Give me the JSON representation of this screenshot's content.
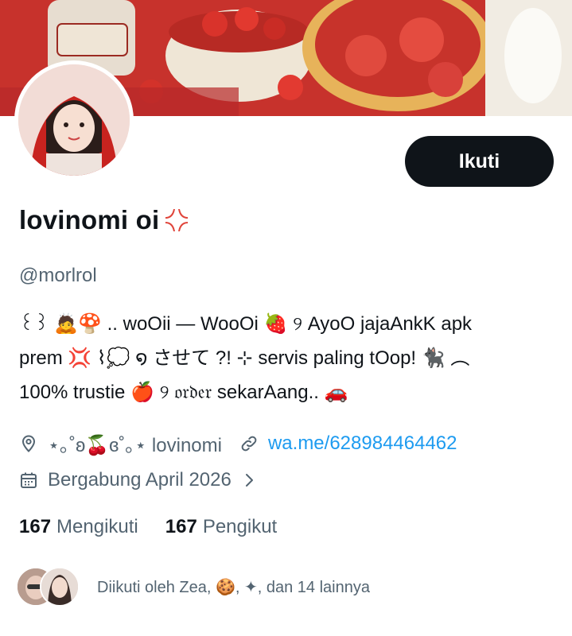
{
  "profile": {
    "follow_label": "Ikuti",
    "display_name": "lovinomi oi",
    "handle": "@morlrol",
    "bio": [
      "꒰꒱ 🙇🍄 ..  woOii — WooOi 🍓 ୨  AyoO jajaAnkK apk",
      "prem 💢 ⌇💭 ໑  させて ?! ⊹ servis paling tOop! 🐈‍⬛ ︵",
      "100% trustie 🍎 ୨  𝔬𝔯𝔡𝔢𝔯 sekarAang.. 🚗"
    ],
    "location": "⋆｡˚ʚ🍒ɞ˚｡⋆ lovinomi",
    "website": "wa.me/628984464462",
    "joined": "Bergabung April 2026",
    "following_count": "167",
    "following_label": "Mengikuti",
    "followers_count": "167",
    "followers_label": "Pengikut",
    "followed_by": "Diikuti oleh Zea, 🍪, ✦, dan 14 lainnya"
  },
  "colors": {
    "text": "#0f1419",
    "secondary": "#536471",
    "link": "#1d9bf0",
    "button": "#0f1419"
  },
  "icons": [
    "anger-icon",
    "location-icon",
    "link-icon",
    "calendar-icon",
    "chevron-right-icon"
  ]
}
